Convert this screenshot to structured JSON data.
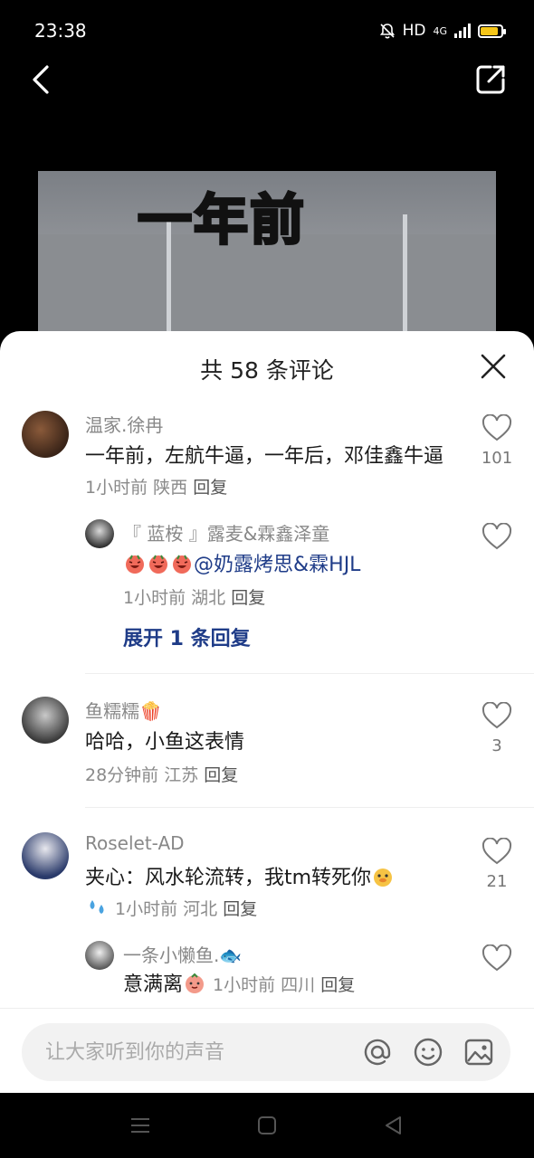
{
  "status": {
    "time": "23:38",
    "hd": "HD",
    "net": "4G",
    "battery_level": 0.85
  },
  "video": {
    "caption": "一年前"
  },
  "sheet": {
    "title": "共 58 条评论"
  },
  "comments": [
    {
      "username": "温家.徐冉",
      "text": "一年前，左航牛逼，一年后，邓佳鑫牛逼",
      "time": "1小时前",
      "location": "陕西",
      "reply_label": "回复",
      "likes": "101",
      "replies": [
        {
          "username": "『 蓝桉 』露麦&霖鑫泽童",
          "mention": "@奶露烤思&霖HJL",
          "time": "1小时前",
          "location": "湖北",
          "reply_label": "回复"
        }
      ],
      "expand_label": "展开 1 条回复"
    },
    {
      "username": "鱼糯糯🍿",
      "text": "哈哈，小鱼这表情",
      "time": "28分钟前",
      "location": "江苏",
      "reply_label": "回复",
      "likes": "3"
    },
    {
      "username": "Roselet-AD",
      "text": "夹心：风水轮流转，我tm转死你",
      "time": "1小时前",
      "location": "河北",
      "reply_label": "回复",
      "likes": "21",
      "replies": [
        {
          "username": "一条小懒鱼.🐟",
          "text": "意满离",
          "time": "1小时前",
          "location": "四川",
          "reply_label": "回复"
        }
      ]
    }
  ],
  "input": {
    "placeholder": "让大家听到你的声音"
  },
  "icons": {
    "back": "back-arrow-icon",
    "share": "share-icon",
    "close": "close-icon",
    "like": "heart-icon",
    "at": "at-icon",
    "emoji": "emoji-icon",
    "image": "image-icon"
  },
  "colors": {
    "accent_link": "#1f3c88",
    "caption_yellow": "#f7e61c"
  }
}
